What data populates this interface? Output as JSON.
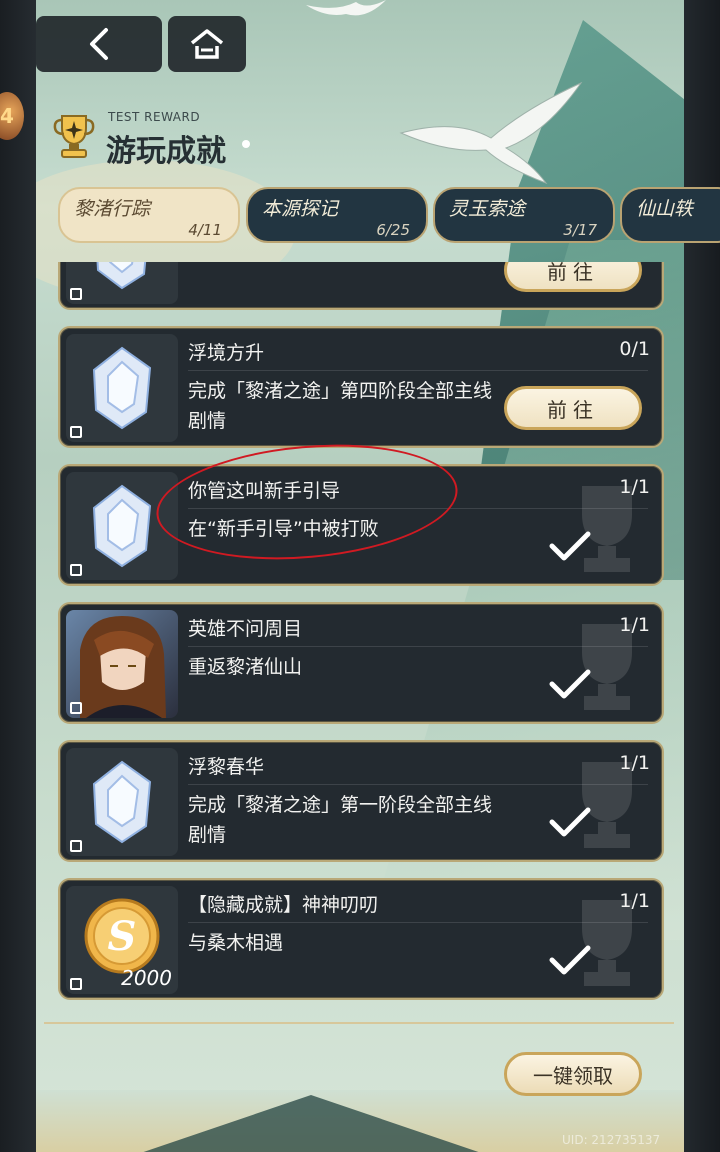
{
  "side": {
    "badge_text": "4"
  },
  "header": {
    "title_en": "TEST REWARD",
    "title_cn": "游玩成就"
  },
  "tabs": [
    {
      "name": "黎渚行踪",
      "count": "4/11",
      "active": true
    },
    {
      "name": "本源探记",
      "count": "6/25",
      "active": false
    },
    {
      "name": "灵玉索途",
      "count": "3/17",
      "active": false
    },
    {
      "name": "仙山轶",
      "count": "",
      "active": false
    }
  ],
  "achievements": [
    {
      "title": "",
      "progress": "",
      "desc": "",
      "status": "goto",
      "button_label": "前往",
      "icon": "crystal-icon"
    },
    {
      "title": "浮境方升",
      "progress": "0/1",
      "desc": "完成「黎渚之途」第四阶段全部主线剧情",
      "status": "goto",
      "button_label": "前往",
      "icon": "crystal-icon"
    },
    {
      "title": "你管这叫新手引导",
      "progress": "1/1",
      "desc": "在“新手引导”中被打败",
      "status": "done",
      "icon": "crystal-icon"
    },
    {
      "title": "英雄不问周目",
      "progress": "1/1",
      "desc": "重返黎渚仙山",
      "status": "done",
      "icon": "character-portrait"
    },
    {
      "title": "浮黎春华",
      "progress": "1/1",
      "desc": "完成「黎渚之途」第一阶段全部主线剧情",
      "status": "done",
      "icon": "crystal-icon"
    },
    {
      "title": "【隐藏成就】神神叨叨",
      "progress": "1/1",
      "desc": "与桑木相遇",
      "status": "done",
      "icon": "coin-icon",
      "reward_amount": "2000"
    }
  ],
  "footer": {
    "claim_all_label": "一键领取",
    "uid_text": "UID: 212735137"
  },
  "colors": {
    "card_bg": "#232a30",
    "card_border": "#b9a877",
    "button_bg": "#f5ecd4",
    "annotation_red": "#d01a22"
  }
}
